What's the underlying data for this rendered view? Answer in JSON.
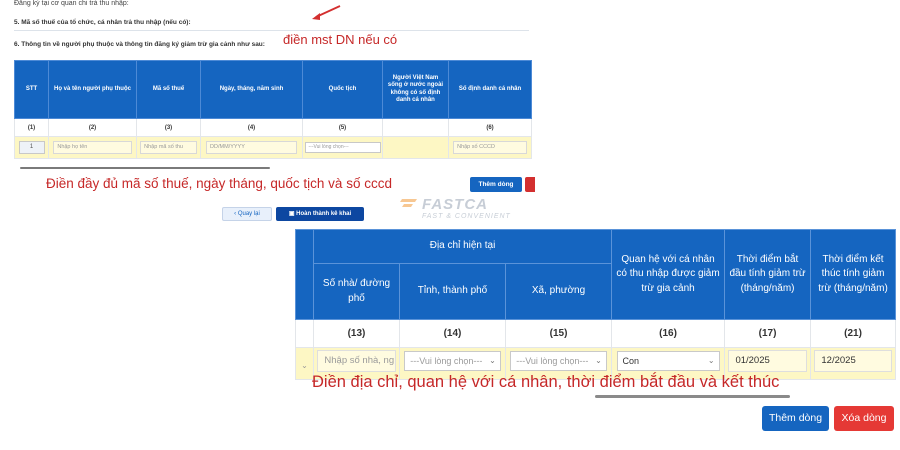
{
  "top": {
    "cut_text": "Đăng ký tại cơ quan chi trả thu nhập:",
    "q5": "5. Mã số thuế của tổ chức, cá nhân trả thu nhập (nếu có):",
    "q6": "6. Thông tin về người phụ thuộc và thông tin đăng ký giảm trừ gia cảnh như sau:",
    "annotation_mst": "điền mst DN nếu có",
    "annotation_fill": "Điền đầy đủ mã số thuế, ngày tháng, quốc tịch và số cccd",
    "table": {
      "headers": [
        "STT",
        "Họ và tên người phụ thuộc",
        "Mã số thuế",
        "Ngày, tháng, năm sinh",
        "Quốc tịch",
        "Người Việt Nam sống ở nước ngoài không có số định danh cá nhân",
        "Số định danh cá nhân"
      ],
      "numbers": [
        "(1)",
        "(2)",
        "(3)",
        "(4)",
        "(5)",
        "",
        "(6)"
      ],
      "row": {
        "stt": "1",
        "name_placeholder": "Nhập họ tên",
        "tax_placeholder": "Nhập mã số thu",
        "dob_placeholder": "DD/MM/YYYY",
        "nationality_placeholder": "---Vui lòng chọn---",
        "id_placeholder": "Nhập số CCCD"
      }
    },
    "btn_add": "Thêm dòng",
    "btn_back": "Quay lại",
    "btn_done": "Hoàn thành kê khai"
  },
  "watermark": {
    "name": "FASTCA",
    "tagline": "FAST & CONVENIENT"
  },
  "bottom": {
    "group_header": "Địa chỉ hiện tại",
    "headers": {
      "house": "Số nhà/ đường phố",
      "province": "Tỉnh, thành phố",
      "ward": "Xã, phường",
      "relation": "Quan hệ với cá nhân có thu nhập được giảm trừ gia cảnh",
      "start": "Thời điểm bắt đầu tính giảm trừ (tháng/năm)",
      "end": "Thời điểm kết thúc tính giảm trừ (tháng/năm)"
    },
    "numbers": [
      "(13)",
      "(14)",
      "(15)",
      "(16)",
      "(17)",
      "(21)"
    ],
    "row": {
      "house_placeholder": "Nhập số nhà, ng",
      "province_placeholder": "---Vui lòng chọn---",
      "ward_placeholder": "---Vui lòng chọn---",
      "relation_value": "Con",
      "start_value": "01/2025",
      "end_value": "12/2025"
    },
    "annotation": "Điền địa chỉ, quan hệ với cá nhân, thời điểm bắt đầu và kết thúc",
    "btn_add": "Thêm dòng",
    "btn_delete": "Xóa dòng"
  },
  "colors": {
    "header_blue": "#1565c0",
    "input_yellow": "#fdf7c4",
    "annotation_red": "#c62828",
    "delete_red": "#e53935"
  }
}
